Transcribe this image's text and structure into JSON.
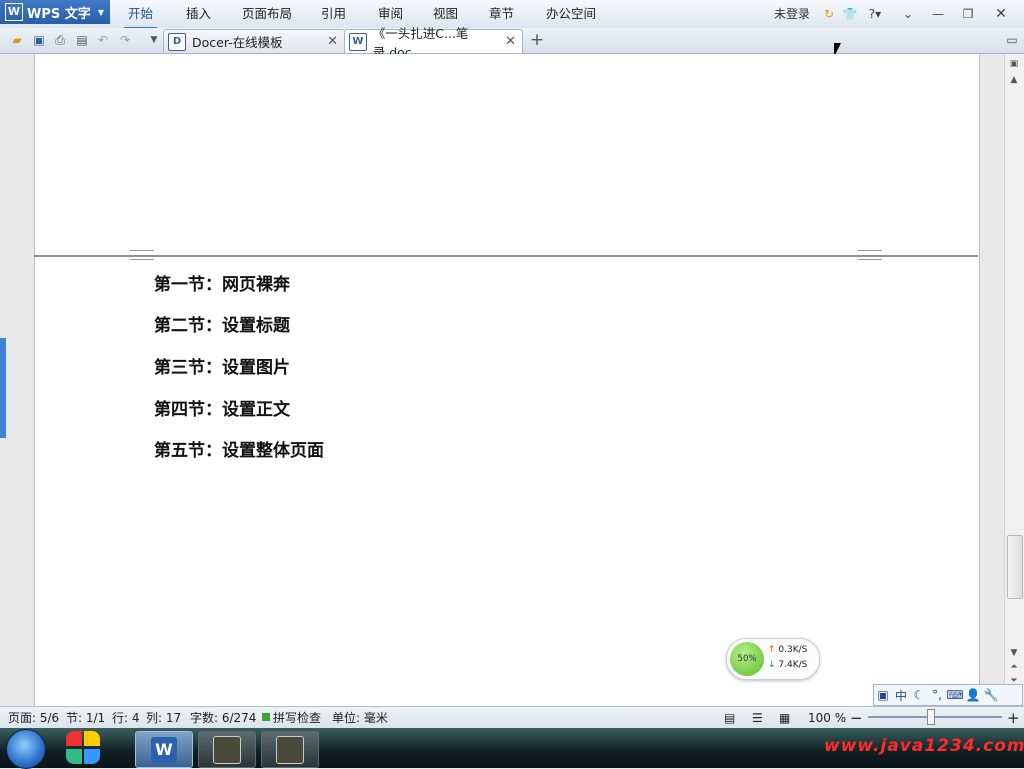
{
  "app": {
    "name": "WPS 文字"
  },
  "menu": [
    "开始",
    "插入",
    "页面布局",
    "引用",
    "审阅",
    "视图",
    "章节",
    "办公空间"
  ],
  "login_text": "未登录",
  "tabs": [
    {
      "label": "Docer-在线模板",
      "icon": "docer-icon"
    },
    {
      "label": "《一头扎进C...笔录.doc",
      "icon": "word-doc-icon"
    }
  ],
  "document": {
    "headings": [
      "第一节：网页裸奔",
      "第二节：设置标题",
      "第三节：设置图片",
      "第四节：设置正文",
      "第五节：设置整体页面"
    ]
  },
  "net_widget": {
    "percent": "50%",
    "upload": "0.3K/S",
    "download": "7.4K/S"
  },
  "ime": [
    "中"
  ],
  "status": {
    "page": "页面: 5/6",
    "section": "节: 1/1",
    "row": "行: 4",
    "col": "列: 17",
    "words": "字数: 6/274",
    "spell": "拼写检查",
    "unit": "单位: 毫米",
    "zoom": "100 %"
  },
  "zoom_fraction": 0.47,
  "watermark": "www.java1234.com",
  "colors": {
    "accent": "#3a73c4",
    "app_button": "#2a5ea8"
  }
}
